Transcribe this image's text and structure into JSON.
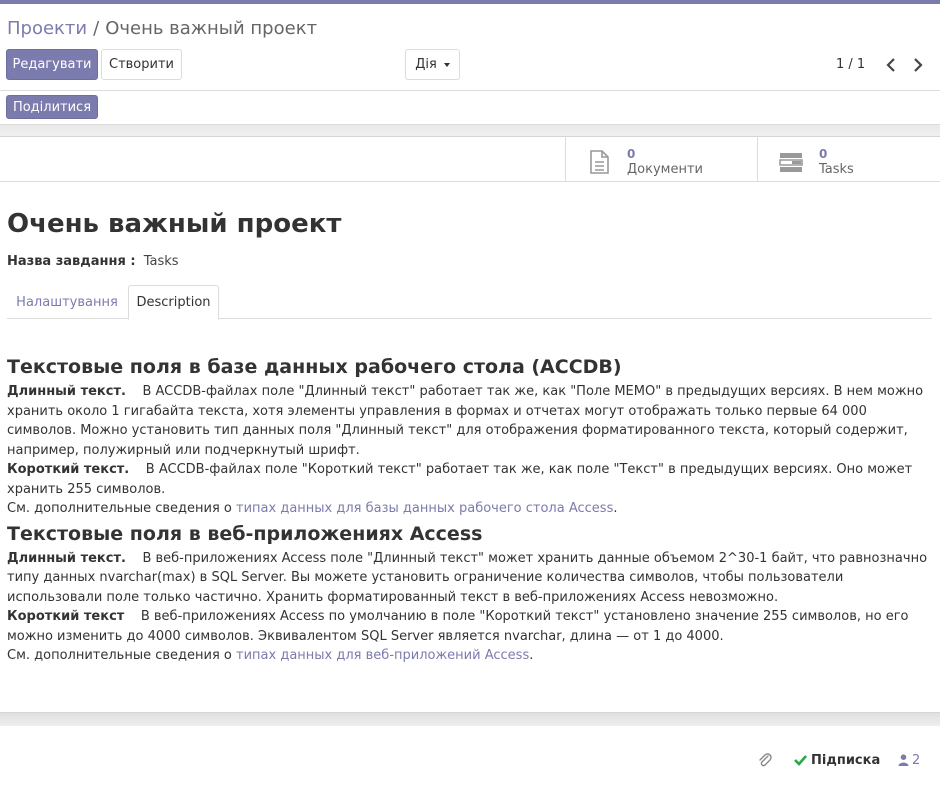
{
  "breadcrumb": {
    "parent": "Проекти",
    "separator": "/",
    "current": "Очень важный проект"
  },
  "toolbar": {
    "edit_label": "Редагувати",
    "create_label": "Створити",
    "action_label": "Дія"
  },
  "pager": {
    "value": "1 / 1"
  },
  "statusbar": {
    "share_label": "Поділитися"
  },
  "stat_buttons": [
    {
      "count": "0",
      "label": "Документи",
      "icon": "file-text-icon"
    },
    {
      "count": "0",
      "label": "Tasks",
      "icon": "tasks-icon"
    }
  ],
  "record": {
    "title": "Очень важный проект",
    "field_label": "Назва завдання :",
    "field_value": "Tasks"
  },
  "tabs": [
    {
      "label": "Налаштування",
      "active": false
    },
    {
      "label": "Description",
      "active": true
    }
  ],
  "description": {
    "h1": "Текстовые поля в базе данных рабочего стола (ACCDB)",
    "p1_bold": "Длинный текст.",
    "p1_text": "В ACCDB-файлах поле \"Длинный текст\" работает так же, как \"Поле MEMO\" в предыдущих версиях. В нем можно хранить около 1 гигабайта текста, хотя элементы управления в формах и отчетах могут отображать только первые 64 000 символов. Можно установить тип данных поля \"Длинный текст\" для отображения форматированного текста, который содержит, например, полужирный или подчеркнутый шрифт.",
    "p2_bold": "Короткий текст.",
    "p2_text": "В ACCDB-файлах поле \"Короткий текст\" работает так же, как поле \"Текст\" в предыдущих версиях. Оно может хранить 255 символов.",
    "p3_prefix": "См. дополнительные сведения о",
    "p3_link": "типах данных для базы данных рабочего стола Access",
    "p3_suffix": ".",
    "h2": "Текстовые поля в веб-приложениях Access",
    "p4_bold": "Длинный текст.",
    "p4_text": "В веб-приложениях Access поле \"Длинный текст\" может хранить данные объемом 2^30-1 байт, что равнозначно типу данных nvarchar(max) в SQL Server. Вы можете установить ограничение количества символов, чтобы пользователи использовали поле только частично. Хранить форматированный текст в веб-приложениях Access невозможно.",
    "p5_bold": "Короткий текст",
    "p5_text": "В веб-приложениях Access по умолчанию в поле \"Короткий текст\" установлено значение 255 символов, но его можно изменить до 4000 символов. Эквивалентом SQL Server является nvarchar, длина — от 1 до 4000.",
    "p6_prefix": "См. дополнительные сведения о",
    "p6_link": "типах данных для веб-приложений Access",
    "p6_suffix": "."
  },
  "chatter": {
    "follow_label": "Підписка",
    "followers_count": "2"
  },
  "colors": {
    "brand": "#7c7bad",
    "follow_check": "#28a745"
  }
}
